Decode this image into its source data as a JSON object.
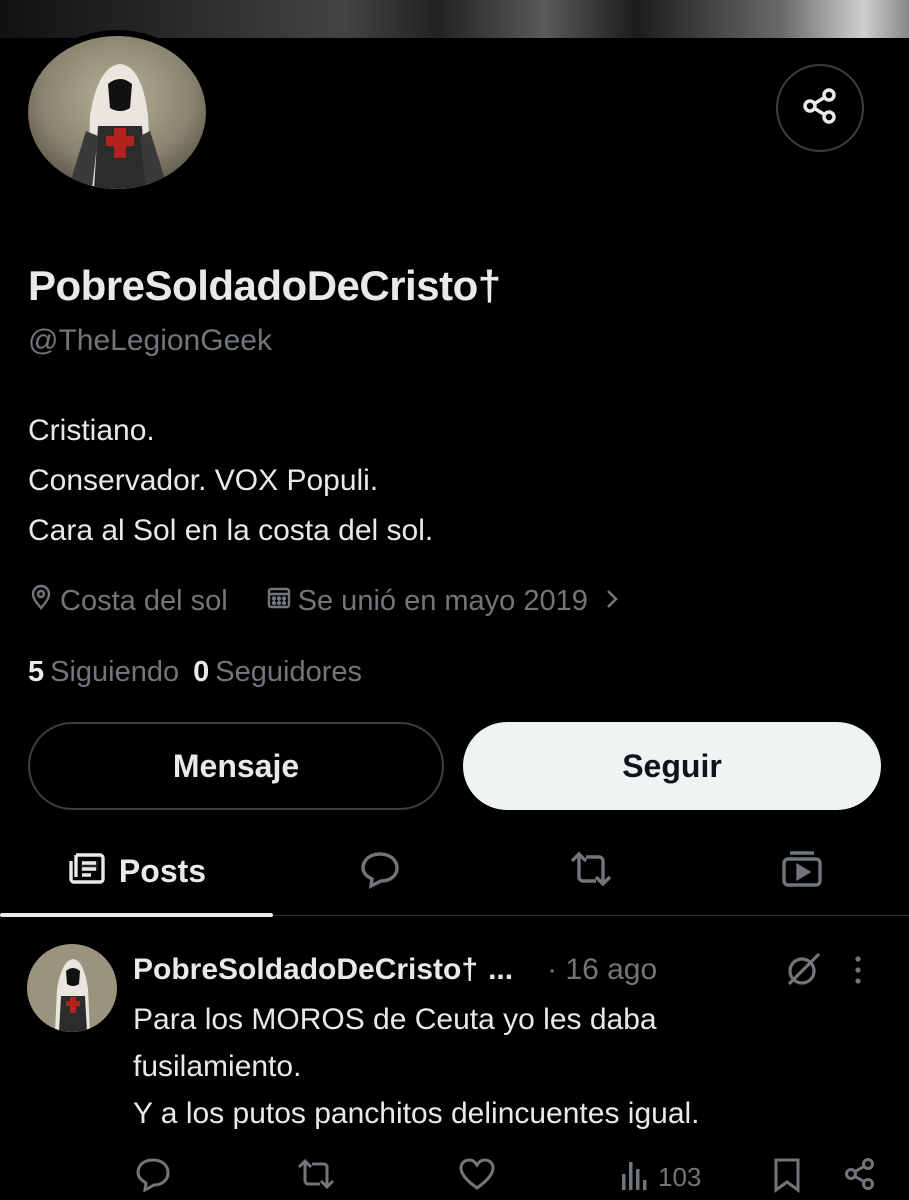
{
  "profile": {
    "name": "PobreSoldadoDeCristo†",
    "handle": "@TheLegionGeek",
    "bio": [
      "Cristiano.",
      "Conservador. VOX Populi.",
      "Cara al Sol en la costa del sol."
    ],
    "location": "Costa del sol",
    "joined": "Se unió en mayo 2019",
    "following_count": "5",
    "following_label": "Siguiendo",
    "followers_count": "0",
    "followers_label": "Seguidores"
  },
  "buttons": {
    "message": "Mensaje",
    "follow": "Seguir"
  },
  "tabs": {
    "posts": "Posts"
  },
  "post": {
    "name": "PobreSoldadoDeCristo†",
    "ellipsis": "...",
    "time": "· 16 ago",
    "lines": [
      "Para los MOROS de Ceuta yo les daba",
      "fusilamiento.",
      "Y a los putos panchitos delincuentes igual."
    ],
    "views": "103"
  },
  "colors": {
    "background": "#000000",
    "text": "#e7e9ea",
    "muted": "#71767b",
    "border": "#2f3336",
    "follow_button": "#eff3f4"
  },
  "icons": [
    "share-icon",
    "location-icon",
    "calendar-icon",
    "chevron-right-icon",
    "posts-icon",
    "reply-icon",
    "repost-icon",
    "media-icon",
    "grok-icon",
    "more-icon",
    "like-icon",
    "views-icon",
    "bookmark-icon"
  ]
}
